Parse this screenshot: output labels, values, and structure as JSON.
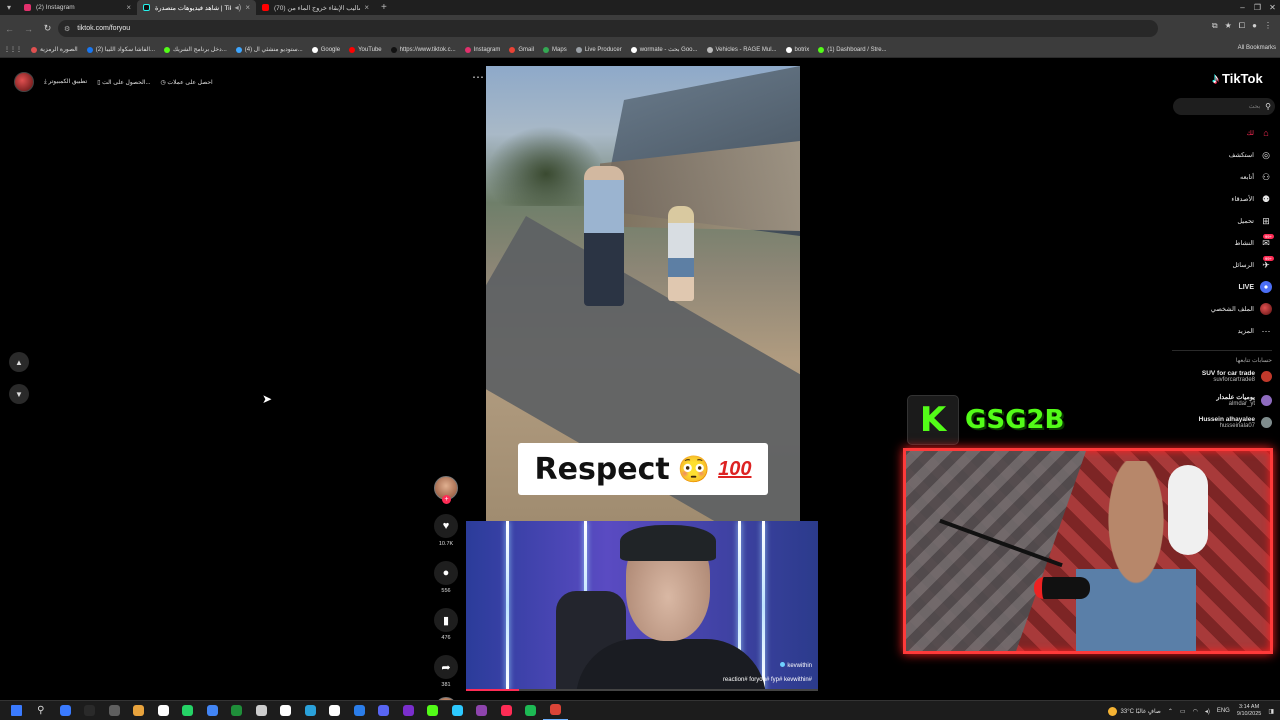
{
  "browser": {
    "tabs": [
      {
        "title": "(2) Instagram",
        "favicon_color": "#e1306c",
        "active": false
      },
      {
        "title": "شاهد فيديوهات متصدرة | TikTok",
        "favicon_color": "#111111",
        "active": true
      },
      {
        "title": "(70) أساليب الإبقاء خروج الماء من",
        "favicon_color": "#ff0000",
        "active": false
      }
    ],
    "url": "tiktok.com/foryou",
    "bookmarks": [
      {
        "label": "الصورة الرمزية",
        "color": "#e05050"
      },
      {
        "label": "(2) الفاشا سكواد الليبا...",
        "color": "#1877f2"
      },
      {
        "label": "دخل برنامج الشريك...",
        "color": "#53fc18"
      },
      {
        "label": "(4) ستوديو منشئي ال...",
        "color": "#3ea6ff"
      },
      {
        "label": "Google",
        "color": "#ffffff"
      },
      {
        "label": "YouTube",
        "color": "#ff0000"
      },
      {
        "label": "https://www.tiktok.c...",
        "color": "#111111"
      },
      {
        "label": "Instagram",
        "color": "#e1306c"
      },
      {
        "label": "Gmail",
        "color": "#ea4335"
      },
      {
        "label": "Maps",
        "color": "#34a853"
      },
      {
        "label": "Live Producer",
        "color": "#9aa0a6"
      },
      {
        "label": "wormate - بحث Goo...",
        "color": "#ffffff"
      },
      {
        "label": "Vehicles - RAGE Mul...",
        "color": "#bbbbbb"
      },
      {
        "label": "botrix",
        "color": "#ffffff"
      },
      {
        "label": "(1) Dashboard / Stre...",
        "color": "#53fc18"
      }
    ],
    "all_bookmarks": "All Bookmarks"
  },
  "page": {
    "top_links": [
      "تطبيق الكمبيوتر",
      "الحصول على الت...",
      "احصل على عملات"
    ],
    "caption": {
      "text": "Respect",
      "emoji": "😳",
      "hundred": "100"
    },
    "actions": {
      "likes": "10.7K",
      "comments": "556",
      "saves": "476",
      "shares": "381"
    },
    "cam1": {
      "handle": "kevwithin",
      "tags": "reaction# foryou# fyp# kevwithin#"
    },
    "progress": 0.15,
    "streamer": {
      "letter": "K",
      "name": "GSG2B"
    }
  },
  "sidebar": {
    "logo": "TikTok",
    "search_placeholder": "بحث",
    "nav": [
      {
        "label": "لك",
        "icon": "⌂",
        "badge": "",
        "active": true,
        "kind": "icon"
      },
      {
        "label": "استكشف",
        "icon": "◎",
        "badge": "",
        "active": false,
        "kind": "icon"
      },
      {
        "label": "أتابعه",
        "icon": "⚇",
        "badge": "",
        "active": false,
        "kind": "icon"
      },
      {
        "label": "الأصدقاء",
        "icon": "⚉",
        "badge": "",
        "active": false,
        "kind": "icon"
      },
      {
        "label": "تحميل",
        "icon": "⊞",
        "badge": "",
        "active": false,
        "kind": "icon"
      },
      {
        "label": "النشاط",
        "icon": "✉",
        "badge": "99+",
        "active": false,
        "kind": "icon"
      },
      {
        "label": "الرسائل",
        "icon": "✈",
        "badge": "99+",
        "active": false,
        "kind": "icon"
      },
      {
        "label": "LIVE",
        "icon": "",
        "badge": "",
        "active": false,
        "kind": "live"
      },
      {
        "label": "الملف الشخصي",
        "icon": "",
        "badge": "",
        "active": false,
        "kind": "profile"
      },
      {
        "label": "المزيد",
        "icon": "⋯",
        "badge": "",
        "active": false,
        "kind": "icon"
      }
    ],
    "following_title": "حسابات تتابعها",
    "following": [
      {
        "name": "SUV for car trade",
        "handle": "suvforcartrade8",
        "color": "#c0392b"
      },
      {
        "name": "يوميات علمدار",
        "handle": "almdar_yt",
        "color": "#8e6bbf"
      },
      {
        "name": "Hussein alhayalee",
        "handle": "husseinala07",
        "color": "#7f8c8d"
      }
    ]
  },
  "taskbar": {
    "apps": [
      "#3a7afe",
      "#2a2a2a",
      "#5f5f5f",
      "#e8a33d",
      "#ffffff",
      "#25d366",
      "#4285f4",
      "#1f8f3a",
      "#cccccc",
      "#ffffff",
      "#2aa1da",
      "#ffffff",
      "#2b7de9",
      "#5865f2",
      "#7a2ecc",
      "#53fc18",
      "#2dc9ff",
      "#8e44ad",
      "#fe2c55",
      "#1db954",
      "#db4437"
    ],
    "weather": "33°C صافٍ غالبًا",
    "lang": "ENG",
    "time": "3:14 AM",
    "date": "9/10/2025"
  }
}
